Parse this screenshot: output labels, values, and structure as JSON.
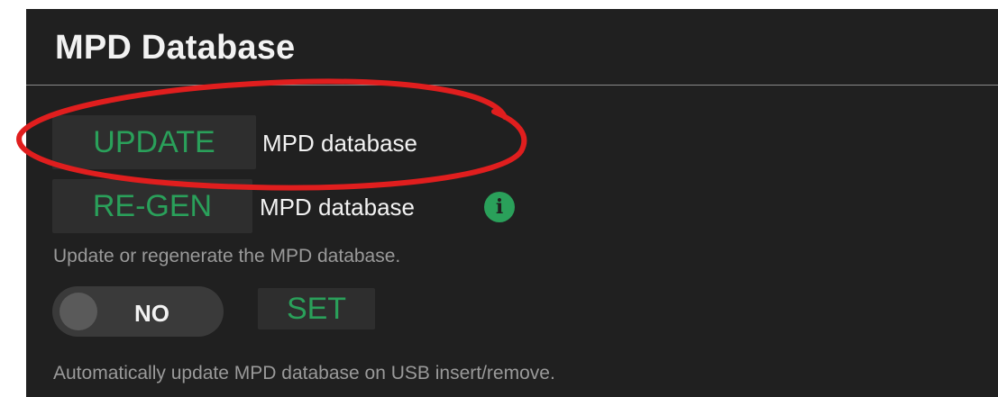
{
  "section": {
    "title": "MPD Database"
  },
  "update": {
    "button_label": "UPDATE",
    "label": "MPD database"
  },
  "regen": {
    "button_label": "RE-GEN",
    "label": "MPD database",
    "info_icon": "info-icon",
    "help": "Update or regenerate the MPD database."
  },
  "auto_update": {
    "toggle_value": "NO",
    "set_label": "SET",
    "help": "Automatically update MPD database on USB insert/remove."
  },
  "colors": {
    "panel_bg": "#202020",
    "button_bg": "#2e2e2e",
    "accent_green": "#2aa05a",
    "text": "#f2f2f2",
    "help_text": "#9a9a9a",
    "annotation_red": "#e01e1e"
  }
}
